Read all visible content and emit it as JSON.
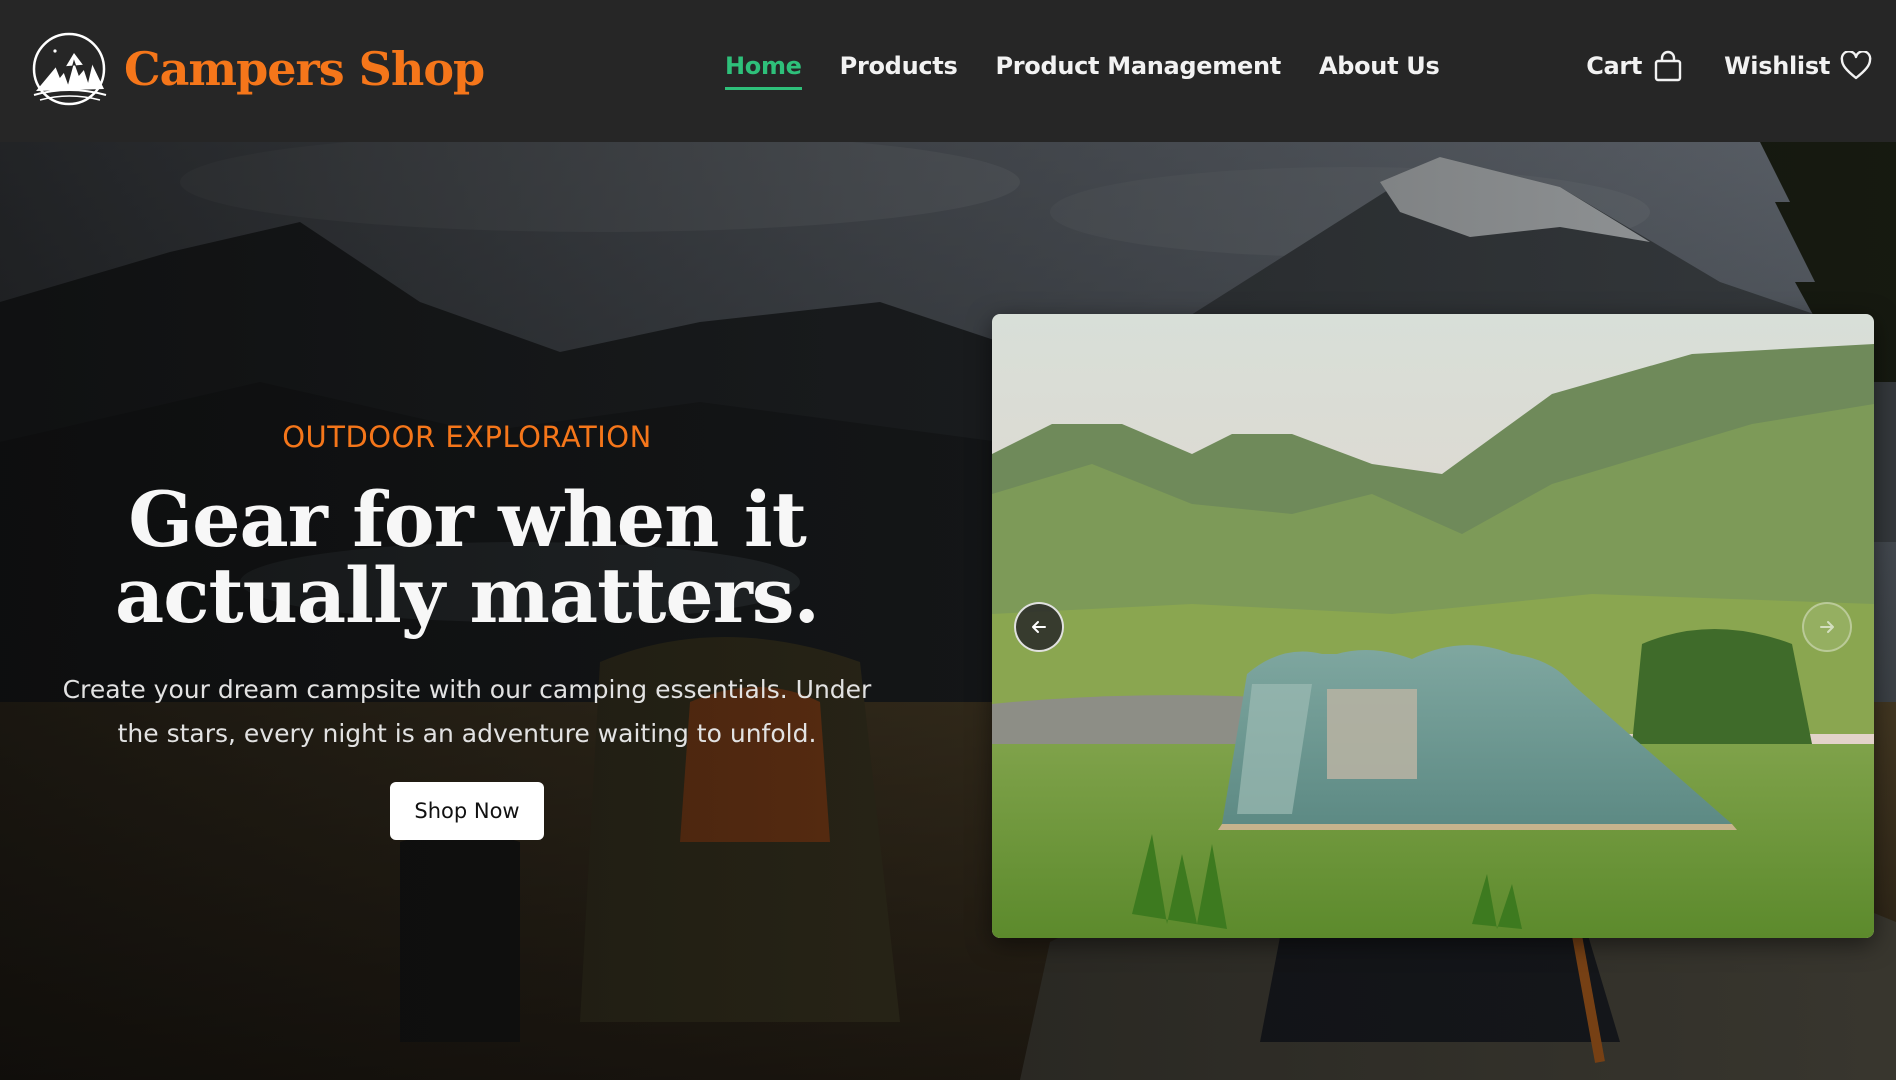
{
  "brand": {
    "name": "Campers Shop",
    "logo_icon": "mountain-moon-logo"
  },
  "nav": {
    "links": [
      {
        "label": "Home",
        "active": true
      },
      {
        "label": "Products",
        "active": false
      },
      {
        "label": "Product Management",
        "active": false
      },
      {
        "label": "About Us",
        "active": false
      }
    ],
    "cart_label": "Cart",
    "cart_icon": "shopping-bag-icon",
    "wishlist_label": "Wishlist",
    "wishlist_icon": "heart-icon"
  },
  "hero": {
    "eyebrow": "OUTDOOR EXPLORATION",
    "title_line1": "Gear for when it",
    "title_line2": "actually matters.",
    "description": "Create your dream campsite with our camping essentials. Under the stars, every night is an adventure waiting to unfold.",
    "cta_label": "Shop Now"
  },
  "carousel": {
    "prev_icon": "arrow-left-icon",
    "next_icon": "arrow-right-icon"
  },
  "colors": {
    "accent_orange": "#f5761a",
    "active_green": "#2ec07a",
    "navbar_bg": "#262626"
  }
}
